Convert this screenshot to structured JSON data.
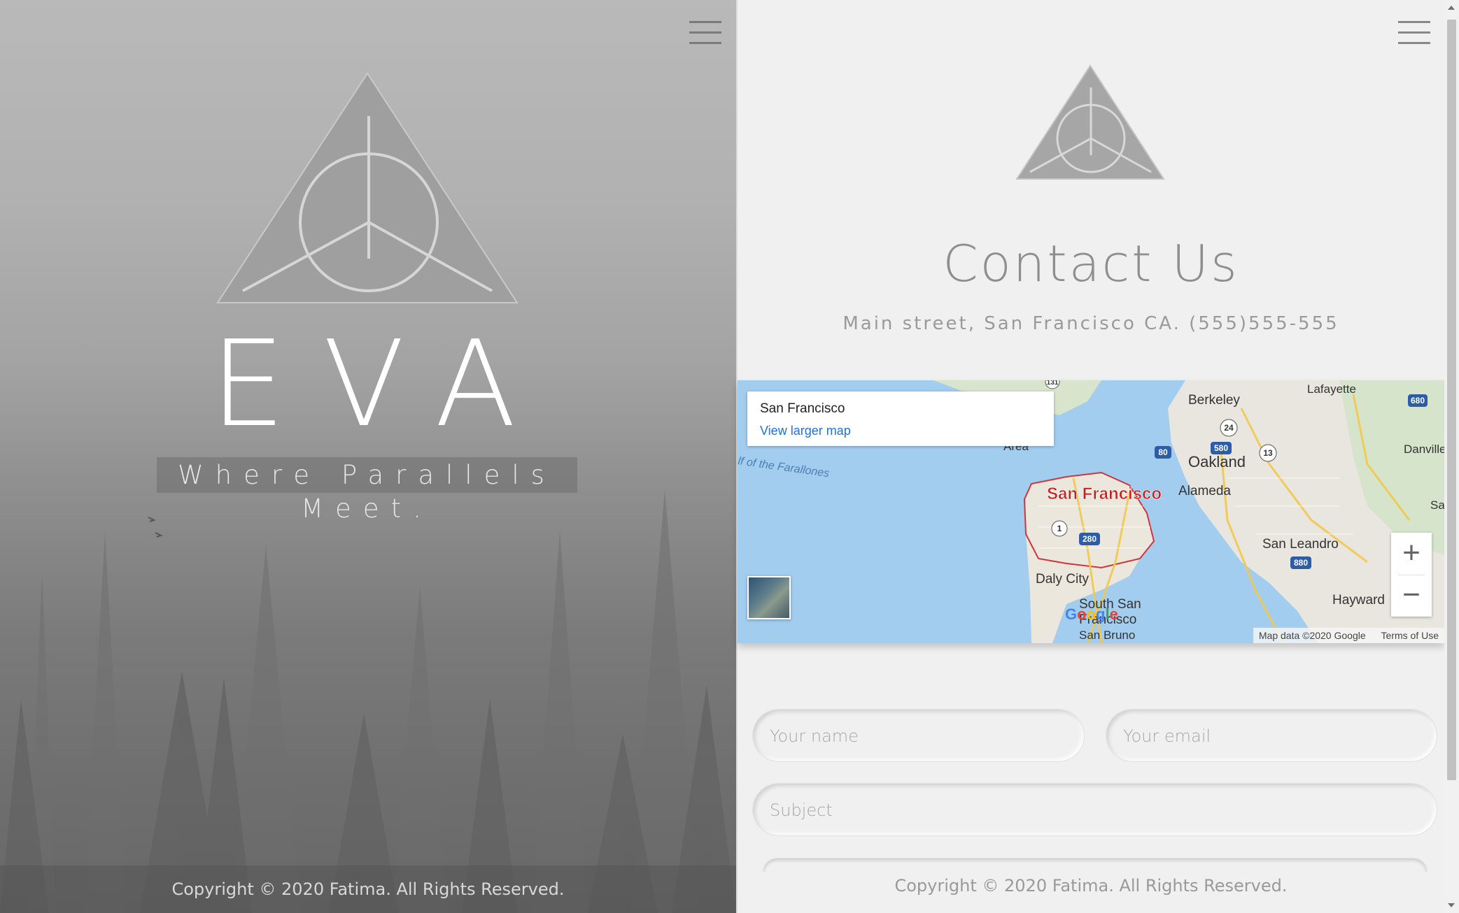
{
  "hero": {
    "brand": "EVA",
    "tagline": "Where Parallels Meet.",
    "copyright": "Copyright © 2020 Fatima. All Rights Reserved."
  },
  "contact": {
    "title": "Contact Us",
    "address": "Main street, San Francisco CA. (555)555-555",
    "map": {
      "place_title": "San Francisco",
      "larger_map_link": "View larger map",
      "zoom_in": "+",
      "zoom_out": "−",
      "attribution": "Map data ©2020 Google",
      "terms": "Terms of Use",
      "google_logo": "Google",
      "labels": {
        "city": "San Francisco",
        "berkeley": "Berkeley",
        "lafayette": "Lafayette",
        "oakland": "Oakland",
        "alameda": "Alameda",
        "danville": "Danville",
        "san_leandro": "San Leandro",
        "hayward": "Hayward",
        "daly_city": "Daly City",
        "south_sf_1": "South San",
        "south_sf_2": "Francisco",
        "san_bruno": "San Bruno",
        "area": "Area",
        "farallones": "lf of the Farallones",
        "sa": "Sa",
        "hw_680a": "680",
        "hw_24": "24",
        "hw_13": "13",
        "hw_580": "580",
        "hw_80": "80",
        "hw_1": "1",
        "hw_280": "280",
        "hw_880": "880",
        "hw_131": "131"
      }
    },
    "form": {
      "name_placeholder": "Your name",
      "email_placeholder": "Your email",
      "subject_placeholder": "Subject"
    },
    "copyright": "Copyright © 2020 Fatima. All Rights Reserved."
  },
  "colors": {
    "map_water": "#a3cdef",
    "map_land": "#e9e6df",
    "city_label": "#c5221f",
    "link": "#1a73e8"
  }
}
